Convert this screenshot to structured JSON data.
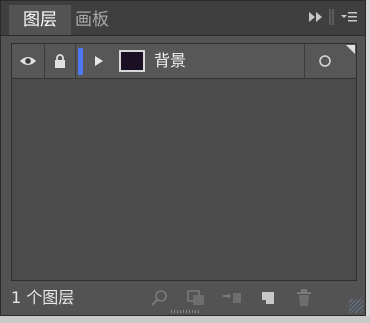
{
  "tabs": [
    {
      "label": "图层",
      "active": true
    },
    {
      "label": "画板",
      "active": false
    }
  ],
  "titlebar_icons": [
    "fast-forward-icon",
    "separator-icon",
    "panel-menu-icon"
  ],
  "layers": [
    {
      "name": "背景",
      "visible": true,
      "locked": true,
      "color": "#4e76f0",
      "thumbnail_color": "#1b0f24"
    }
  ],
  "footer": {
    "count_text": "1 个图层",
    "icons": [
      "search-icon",
      "make-clipping-mask-icon",
      "create-sublayer-icon",
      "new-layer-icon",
      "delete-icon"
    ]
  },
  "colors": {
    "panel_bg": "#535353",
    "titlebar_bg": "#3f3f3f",
    "list_bg": "#4b4b4b",
    "row_bg": "#575757",
    "layer_color": "#4e76f0"
  }
}
